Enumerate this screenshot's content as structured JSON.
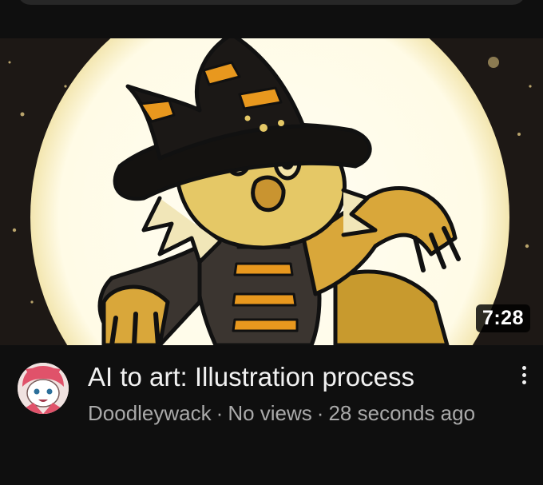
{
  "video": {
    "duration": "7:28",
    "title": "AI to art: Illustration process",
    "channel": "Doodleywack",
    "views": "No views",
    "age": "28 seconds ago",
    "separator": "·"
  },
  "icons": {
    "more": "more-vert-icon",
    "avatar": "channel-avatar"
  },
  "colors": {
    "background": "#0f0f0f",
    "title": "#f1f1f1",
    "secondary_text": "#aaaaaa",
    "duration_badge": "#000000"
  }
}
